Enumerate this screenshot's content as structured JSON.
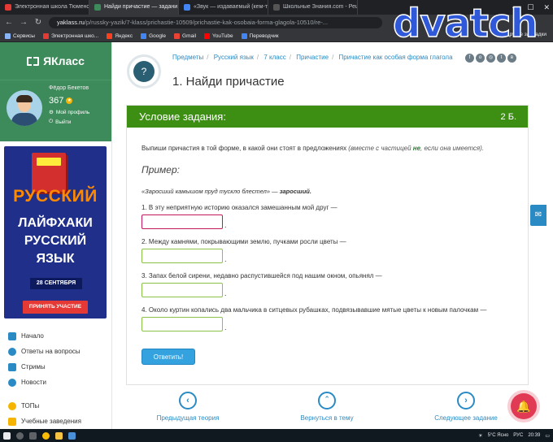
{
  "browser": {
    "tabs": [
      {
        "title": "Электронная школа Тюменск",
        "color": "#e53935"
      },
      {
        "title": "Найди причастие — задани",
        "color": "#3d8b5a"
      },
      {
        "title": "«Звук — издаваемый (кем-то",
        "color": "#4285f4"
      },
      {
        "title": "Школьные Знания.com - Реш",
        "color": "#555555"
      }
    ],
    "url_host": "yaklass.ru",
    "url_rest": "/p/russky-yazik/7-klass/prichastie-10509/prichastie-kak-osobaia-forma-glagola-10510/re-...",
    "bookmarks": [
      "Сервисы",
      "Электронная шко...",
      "Яндекс",
      "Google",
      "Gmail",
      "YouTube",
      "Переводчик"
    ],
    "bookmarks_right": "Другие закладки"
  },
  "watermark": "dvatch",
  "sidebar": {
    "logo": "ЯКласс",
    "user_name": "Фёдор Бекетов",
    "points": "367",
    "profile_link": "Мой профиль",
    "logout_link": "Выйти",
    "banner": {
      "word1": "РУССКИЙ",
      "word2_line1": "ЛАЙФХАКИ",
      "word2_line2": "РУССКИЙ",
      "word2_line3": "ЯЗЫК",
      "date": "28 СЕНТЯБРЯ",
      "button": "ПРИНЯТЬ УЧАСТИЕ"
    },
    "nav": [
      {
        "label": "Начало",
        "color": "#2a8bc4"
      },
      {
        "label": "Ответы на вопросы",
        "color": "#2a8bc4"
      },
      {
        "label": "Стримы",
        "color": "#2a8bc4"
      },
      {
        "label": "Новости",
        "color": "#2a8bc4"
      }
    ],
    "nav2": [
      {
        "label": "ТОПы",
        "color": "#f5b400"
      },
      {
        "label": "Учебные заведения",
        "color": "#f5b400"
      }
    ]
  },
  "main": {
    "breadcrumbs": [
      "Предметы",
      "Русский язык",
      "7 класс",
      "Причастие",
      "Причастие как особая форма глагола"
    ],
    "title": "1. Найди причастие",
    "panel_title": "Условие задания:",
    "panel_points": "2 Б.",
    "intro_text": "Выпиши причастия в той форме, в какой они стоят в предложениях ",
    "intro_italic_1": "(вместе с частицей ",
    "intro_ne": "не",
    "intro_italic_2": ", если она имеется).",
    "example_heading": "Пример:",
    "example_text": "«Заросший камышом пруд тускло блестел» — ",
    "example_answer": "заросший.",
    "questions": [
      "1. В эту неприятную историю оказался замешанным мой друг —",
      "2. Между камнями, покрывающими землю, пучками росли цветы —",
      "3. Запах белой сирени, недавно распустившейся под нашим окном, опьянял —",
      "4. Около куртин копались два мальчика в ситцевых рубашках, подвязывавшие мятые цветы к новым палочкам —"
    ],
    "answer_button": "Ответить!",
    "prev_label": "Предыдущая теория",
    "back_label": "Вернуться в тему",
    "next_label": "Следующее задание"
  },
  "taskbar": {
    "weather": "5°C Ясно",
    "lang": "РУС",
    "time": "20:39"
  }
}
